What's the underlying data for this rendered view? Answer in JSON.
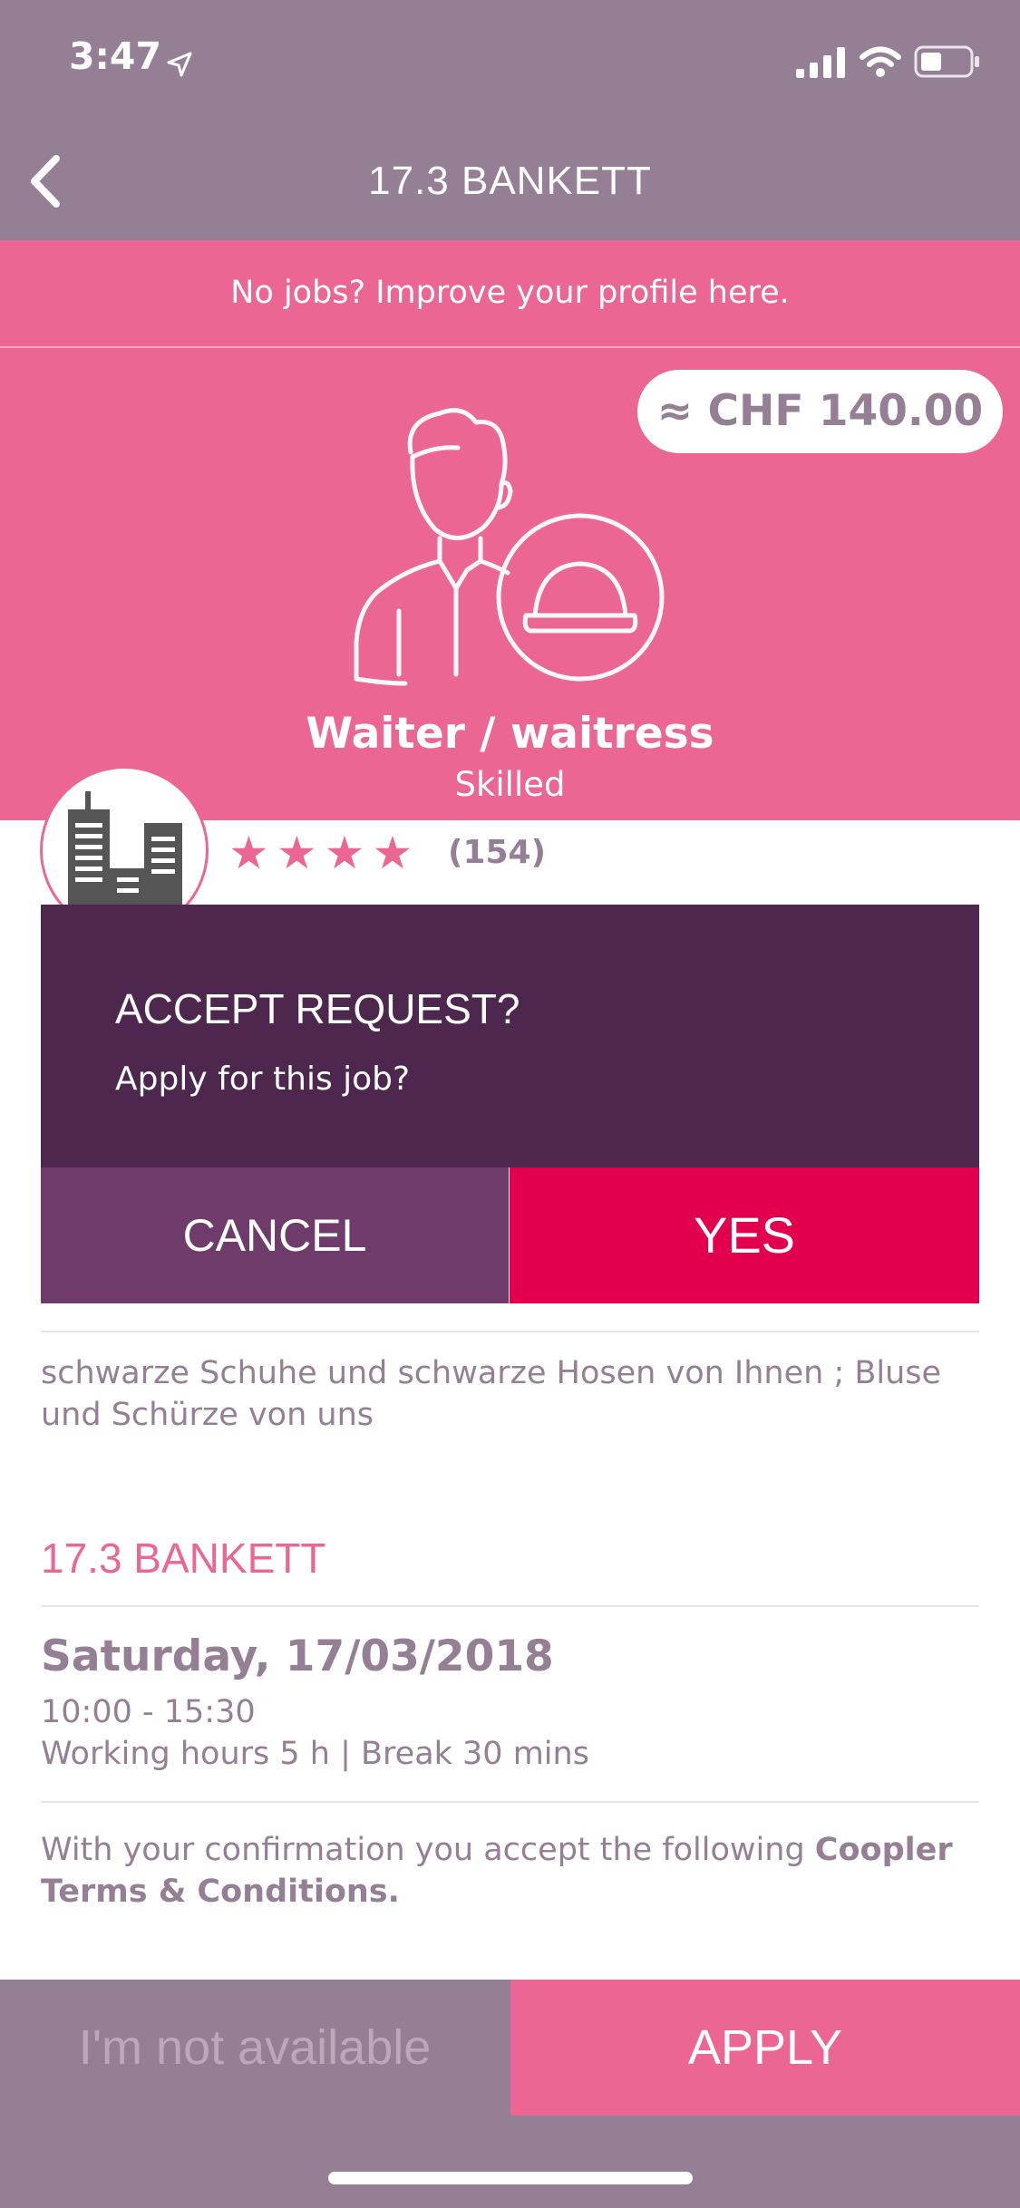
{
  "status_bar": {
    "time": "3:47"
  },
  "nav": {
    "title": "17.3 BANKETT"
  },
  "promo": {
    "text": "No jobs? Improve your profile here."
  },
  "hero": {
    "price": "≈ CHF 140.00",
    "job_title": "Waiter / waitress",
    "job_level": "Skilled"
  },
  "rating": {
    "stars": 4,
    "count": "(154)"
  },
  "dialog": {
    "title": "ACCEPT REQUEST?",
    "message": "Apply for this job?",
    "cancel_label": "CANCEL",
    "yes_label": "YES"
  },
  "details": {
    "description": "schwarze Schuhe und schwarze Hosen von Ihnen ; Bluse und Schürze von uns",
    "section_title": "17.3 BANKETT",
    "date": "Saturday, 17/03/2018",
    "time": "10:00 - 15:30",
    "hours": "Working hours 5 h |  Break 30 mins",
    "terms_text": "With your confirmation you accept the following ",
    "terms_link": "Coopler Terms & Conditions."
  },
  "bottom": {
    "not_available_label": "I'm not available",
    "apply_label": "APPLY"
  },
  "colors": {
    "header": "#947f94",
    "brand_pink": "#ec6694",
    "dialog_dark": "#4e274e",
    "cancel_purple": "#6e3b6b",
    "yes_red": "#e2004e"
  }
}
